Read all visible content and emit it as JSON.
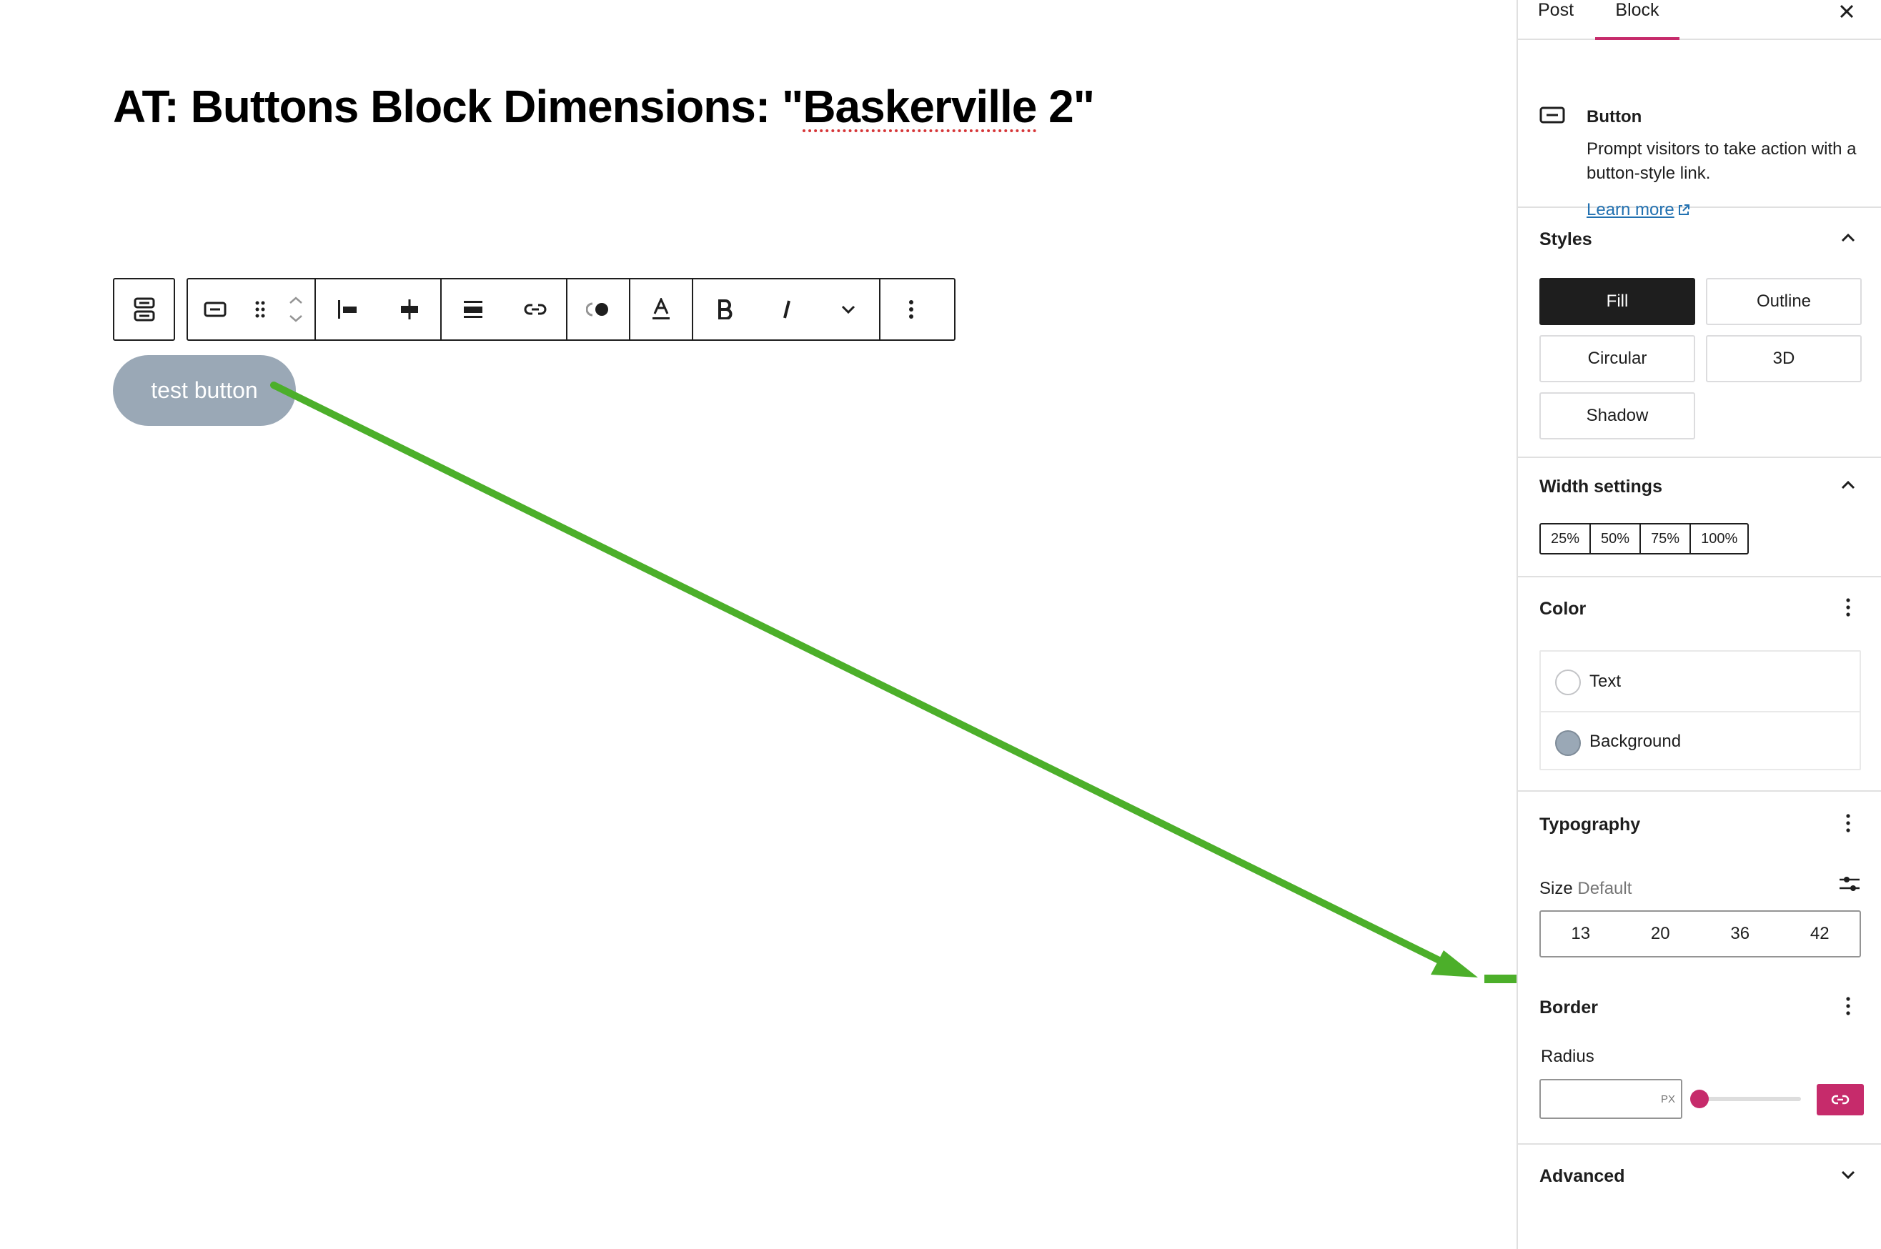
{
  "post": {
    "title_prefix": "AT: Buttons Block Dimensions: \"",
    "title_word": "Baskerville",
    "title_suffix": " 2\"",
    "button_text": "test button"
  },
  "sidebar": {
    "tabs": {
      "post": "Post",
      "block": "Block"
    },
    "block_card": {
      "title": "Button",
      "description": "Prompt visitors to take action with a button-style link.",
      "learn_more": "Learn more"
    },
    "styles": {
      "title": "Styles",
      "options": [
        "Fill",
        "Outline",
        "Circular",
        "3D",
        "Shadow"
      ],
      "active": "Fill"
    },
    "width_settings": {
      "title": "Width settings",
      "options": [
        "25%",
        "50%",
        "75%",
        "100%"
      ]
    },
    "color": {
      "title": "Color",
      "items": [
        {
          "label": "Text",
          "swatch": "#ffffff"
        },
        {
          "label": "Background",
          "swatch": "#9aa8b6"
        }
      ]
    },
    "typography": {
      "title": "Typography",
      "size_label": "Size",
      "size_value": "Default",
      "sizes": [
        "13",
        "20",
        "36",
        "42"
      ]
    },
    "border": {
      "title": "Border",
      "radius_label": "Radius",
      "radius_value": "",
      "unit": "PX"
    },
    "advanced": {
      "title": "Advanced"
    }
  },
  "colors": {
    "accent": "#c62b6b",
    "button_bg": "#9aa8b6",
    "annotation_arrow": "#4caf2a"
  },
  "icons": {
    "toolbar": [
      "buttons-parent-icon",
      "button-block-icon",
      "drag-handle-icon",
      "move-up-icon",
      "move-down-icon",
      "justify-left-icon",
      "justify-center-icon",
      "align-wide-icon",
      "link-icon",
      "highlight-icon",
      "text-color-icon",
      "bold-icon",
      "italic-icon",
      "more-rich-text-icon",
      "more-options-icon"
    ]
  }
}
